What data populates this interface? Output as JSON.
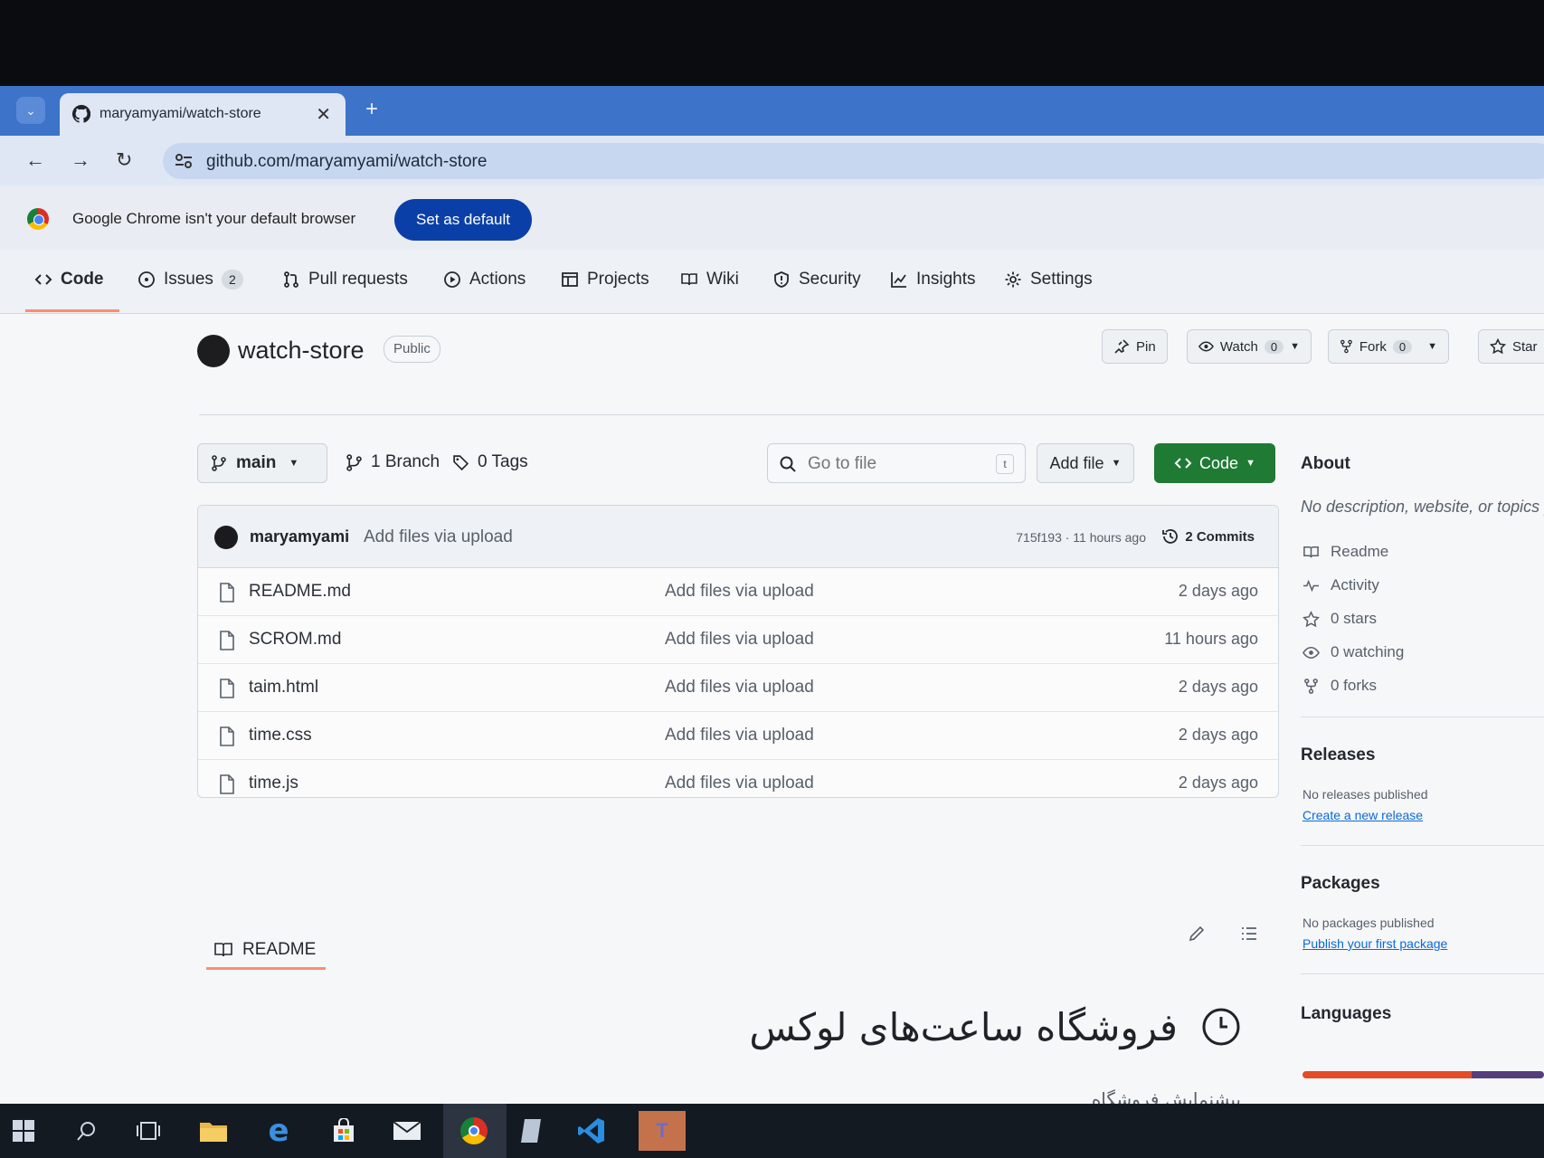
{
  "browser": {
    "tab_title": "maryamyami/watch-store",
    "url": "github.com/maryamyami/watch-store",
    "infobar_message": "Google Chrome isn't your default browser",
    "infobar_button": "Set as default"
  },
  "repo_nav": {
    "items": [
      {
        "label": "Code",
        "icon": "code-icon",
        "active": true
      },
      {
        "label": "Issues",
        "icon": "issue-icon",
        "count": "2"
      },
      {
        "label": "Pull requests",
        "icon": "pull-request-icon"
      },
      {
        "label": "Actions",
        "icon": "play-icon"
      },
      {
        "label": "Projects",
        "icon": "table-icon"
      },
      {
        "label": "Wiki",
        "icon": "book-icon"
      },
      {
        "label": "Security",
        "icon": "shield-icon"
      },
      {
        "label": "Insights",
        "icon": "graph-icon"
      },
      {
        "label": "Settings",
        "icon": "gear-icon"
      }
    ]
  },
  "repo": {
    "name": "watch-store",
    "visibility": "Public",
    "pin_label": "Pin",
    "watch_label": "Watch",
    "watch_count": "0",
    "fork_label": "Fork",
    "fork_count": "0",
    "star_label": "Star"
  },
  "branch_bar": {
    "branch": "main",
    "branches": "1 Branch",
    "tags": "0 Tags",
    "go_to_file_placeholder": "Go to file",
    "go_to_file_key": "t",
    "add_file": "Add file",
    "code": "Code"
  },
  "latest_commit": {
    "user": "maryamyami",
    "message": "Add files via upload",
    "meta": "715f193 · 11 hours ago",
    "commits": "2 Commits"
  },
  "files": [
    {
      "name": "README.md",
      "message": "Add files via upload",
      "date": "2 days ago"
    },
    {
      "name": "SCROM.md",
      "message": "Add files via upload",
      "date": "11 hours ago"
    },
    {
      "name": "taim.html",
      "message": "Add files via upload",
      "date": "2 days ago"
    },
    {
      "name": "time.css",
      "message": "Add files via upload",
      "date": "2 days ago"
    },
    {
      "name": "time.js",
      "message": "Add files via upload",
      "date": "2 days ago"
    }
  ],
  "readme": {
    "tab_label": "README",
    "heading": "فروشگاه ساعت‌های لوکس",
    "subtitle": "پیشنمایش فروشگاه"
  },
  "sidebar": {
    "about_title": "About",
    "description": "No description, website, or topics provided.",
    "readme": "Readme",
    "activity": "Activity",
    "stars": "0 stars",
    "watching": "0 watching",
    "forks": "0 forks",
    "releases_title": "Releases",
    "releases_none": "No releases published",
    "releases_link": "Create a new release",
    "packages_title": "Packages",
    "packages_none": "No packages published",
    "packages_link": "Publish your first package",
    "languages_title": "Languages",
    "language_colors": [
      "#e34c26",
      "#563d7c"
    ]
  },
  "colors": {
    "tab_strip": "#3d73c9",
    "code_button": "#1f7a34",
    "active_underline": "#fd8c73",
    "link": "#0969da"
  },
  "taskbar": {
    "icons": [
      "windows-start-icon",
      "search-icon",
      "task-view-icon",
      "file-explorer-icon",
      "edge-icon",
      "store-icon",
      "mail-icon",
      "chrome-icon",
      "notepad-icon",
      "vscode-icon",
      "teams-icon"
    ]
  }
}
